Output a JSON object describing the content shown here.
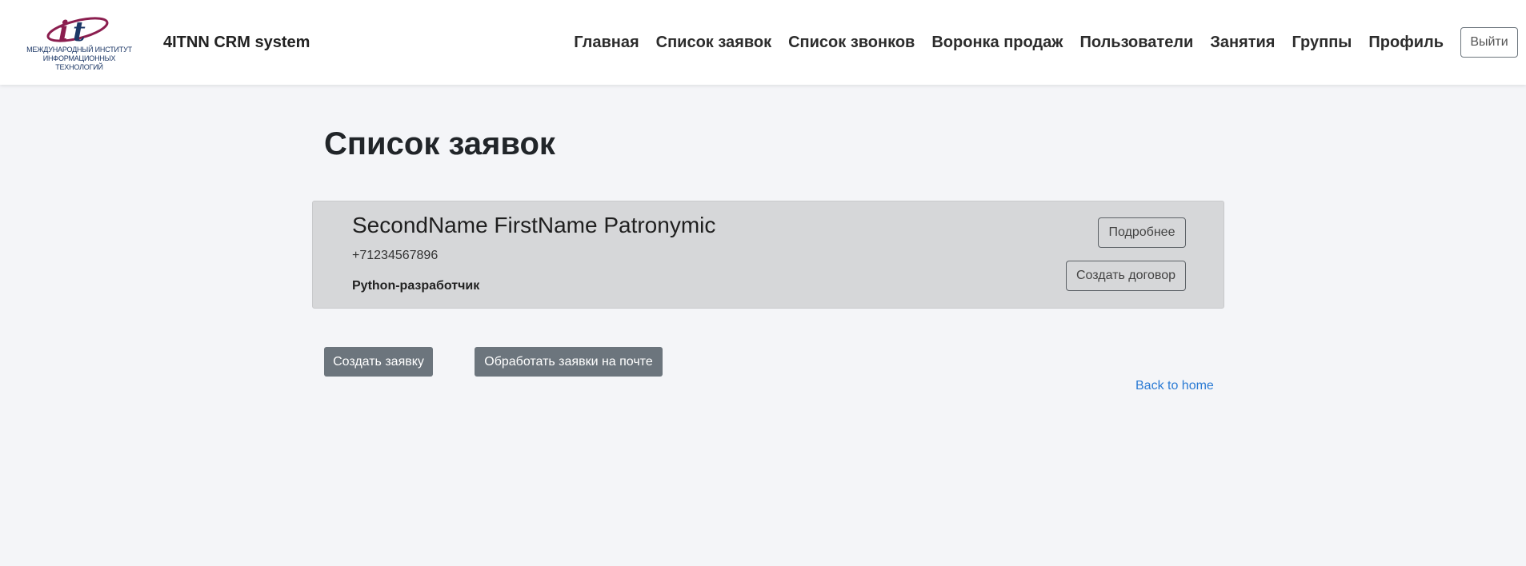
{
  "header": {
    "logo_caption_lines": [
      "МЕЖДУНАРОДНЫЙ ИНСТИТУТ",
      "ИНФОРМАЦИОННЫХ",
      "ТЕХНОЛОГИЙ"
    ],
    "brand": "4ITNN CRM system",
    "nav": [
      "Главная",
      "Список заявок",
      "Список звонков",
      "Воронка продаж",
      "Пользователи",
      "Занятия",
      "Группы",
      "Профиль"
    ],
    "logout_label": "Выйти"
  },
  "main": {
    "title": "Список заявок",
    "requests": [
      {
        "name": "SecondName FirstName Patronymic",
        "phone": "+71234567896",
        "position": "Python-разработчик",
        "details_label": "Подробнее",
        "contract_label": "Создать договор"
      }
    ],
    "create_request_label": "Создать заявку",
    "process_mail_label": "Обработать заявки на почте",
    "back_link": "Back to home"
  },
  "colors": {
    "background": "#f4f5f8",
    "card": "#d6d7d9",
    "secondary_button": "#6c757d",
    "link": "#2b7bd4",
    "logo_magenta": "#8b1e4f",
    "logo_navy": "#1c3766"
  },
  "icons": [
    "logo-icon"
  ]
}
